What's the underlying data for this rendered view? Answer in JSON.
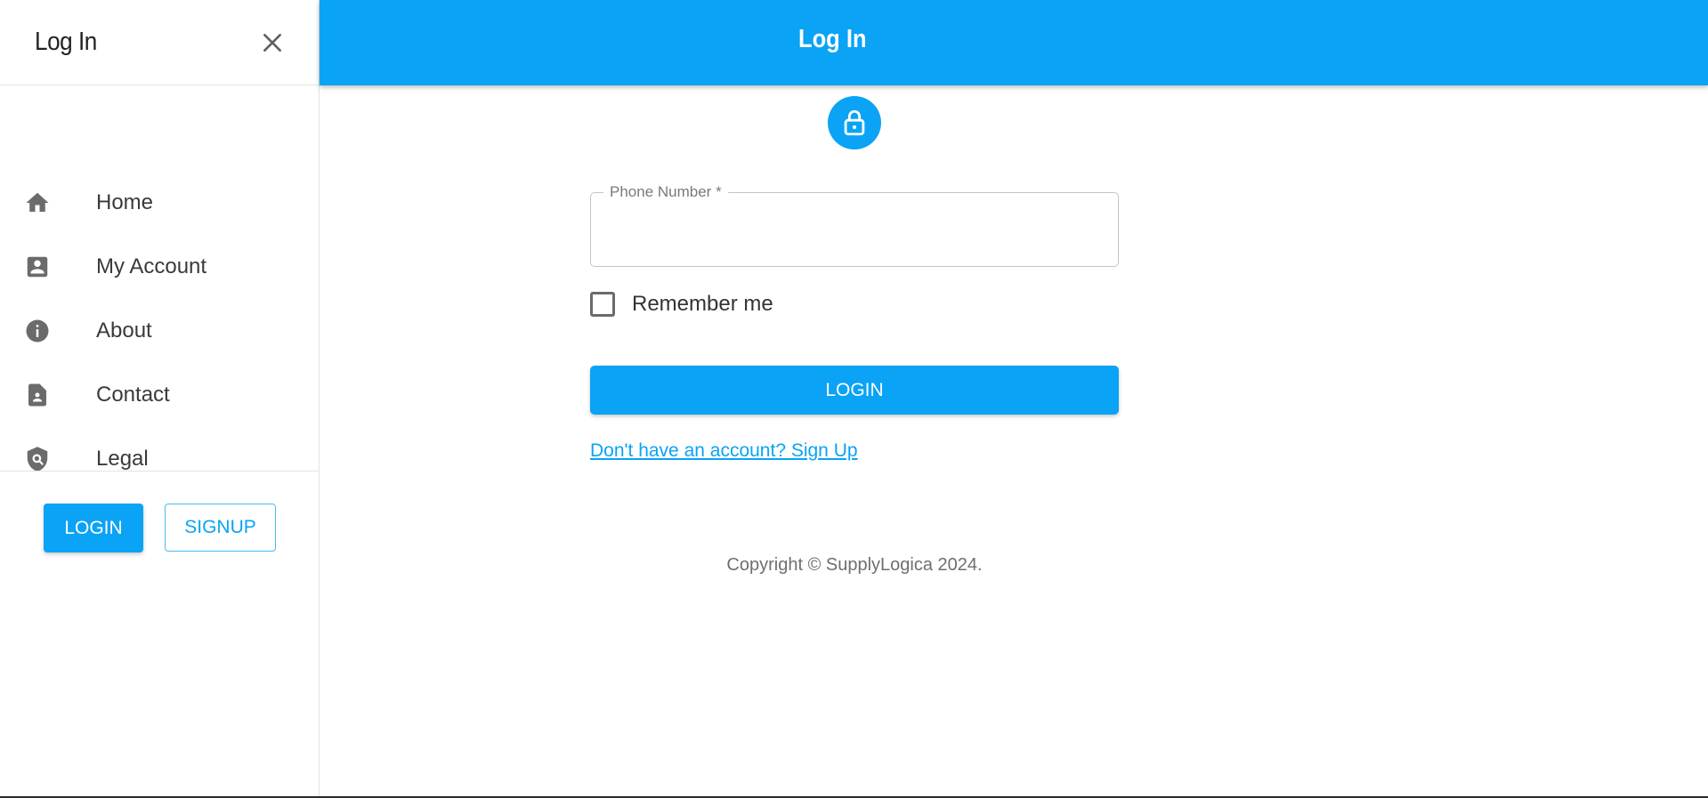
{
  "drawer": {
    "title": "Log In",
    "close_icon": "close-icon",
    "items": [
      {
        "label": "Home",
        "icon": "home-icon"
      },
      {
        "label": "My Account",
        "icon": "account-box-icon"
      },
      {
        "label": "About",
        "icon": "info-icon"
      },
      {
        "label": "Contact",
        "icon": "contact-page-icon"
      },
      {
        "label": "Legal",
        "icon": "policy-icon"
      }
    ],
    "login_label": "LOGIN",
    "signup_label": "SIGNUP"
  },
  "appbar": {
    "title": "Log In"
  },
  "form": {
    "lock_icon": "lock-icon",
    "phone": {
      "label": "Phone Number *",
      "value": ""
    },
    "remember_label": "Remember me",
    "remember_checked": false,
    "login_label": "LOGIN",
    "signup_link": "Don't have an account? Sign Up"
  },
  "footer": {
    "copyright": "Copyright © SupplyLogica 2024."
  },
  "colors": {
    "accent": "#0aa3f5",
    "icon_gray": "#6b6b6b",
    "text": "#333333"
  }
}
